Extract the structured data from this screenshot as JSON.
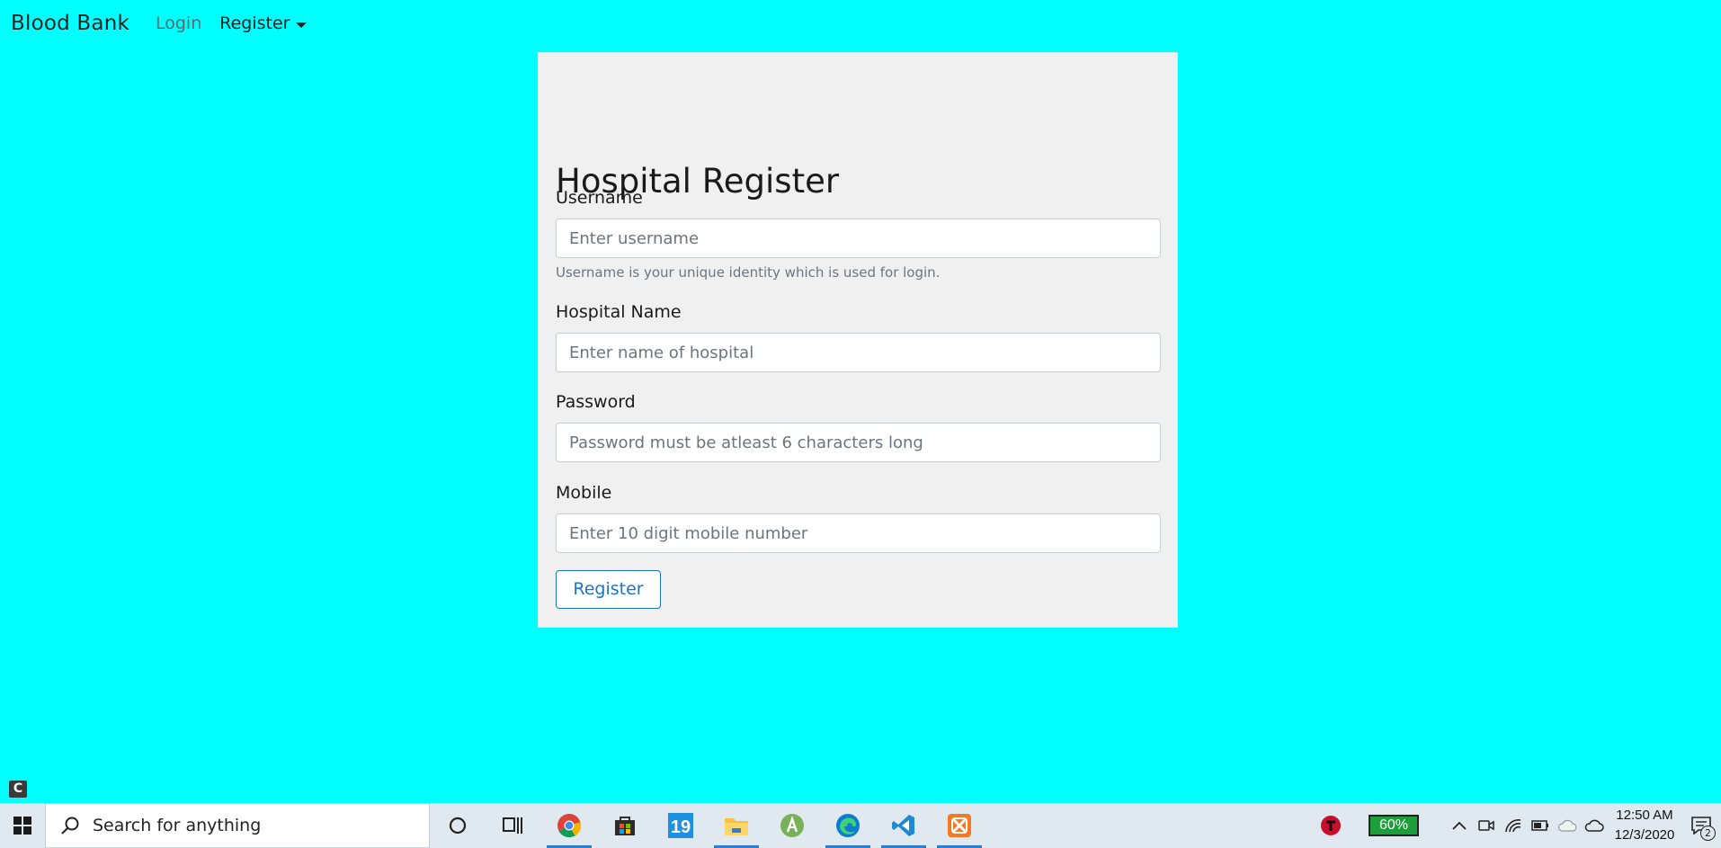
{
  "navbar": {
    "brand": "Blood Bank",
    "login_label": "Login",
    "register_label": "Register"
  },
  "form": {
    "title": "Hospital Register",
    "username": {
      "label": "Username",
      "placeholder": "Enter username",
      "value": "",
      "help": "Username is your unique identity which is used for login."
    },
    "hospital_name": {
      "label": "Hospital Name",
      "placeholder": "Enter name of hospital",
      "value": ""
    },
    "password": {
      "label": "Password",
      "placeholder": "Password must be atleast 6 characters long",
      "value": ""
    },
    "mobile": {
      "label": "Mobile",
      "placeholder": "Enter 10 digit mobile number",
      "value": ""
    },
    "submit_label": "Register"
  },
  "colors": {
    "page_background": "#00ffff",
    "card_background": "#f0f0f0",
    "button_accent": "#1a73c9"
  },
  "corner_badge": "C",
  "taskbar": {
    "search_placeholder": "Search for anything",
    "apps": [
      "cortana-icon",
      "task-view-icon",
      "chrome-icon",
      "store-icon",
      "calendar-icon",
      "file-explorer-icon",
      "android-studio-icon",
      "edge-icon",
      "vscode-icon",
      "xampp-icon"
    ],
    "calendar_day": "19",
    "battery_percent": "60%",
    "time": "12:50 AM",
    "date": "12/3/2020",
    "notification_count": "2"
  }
}
